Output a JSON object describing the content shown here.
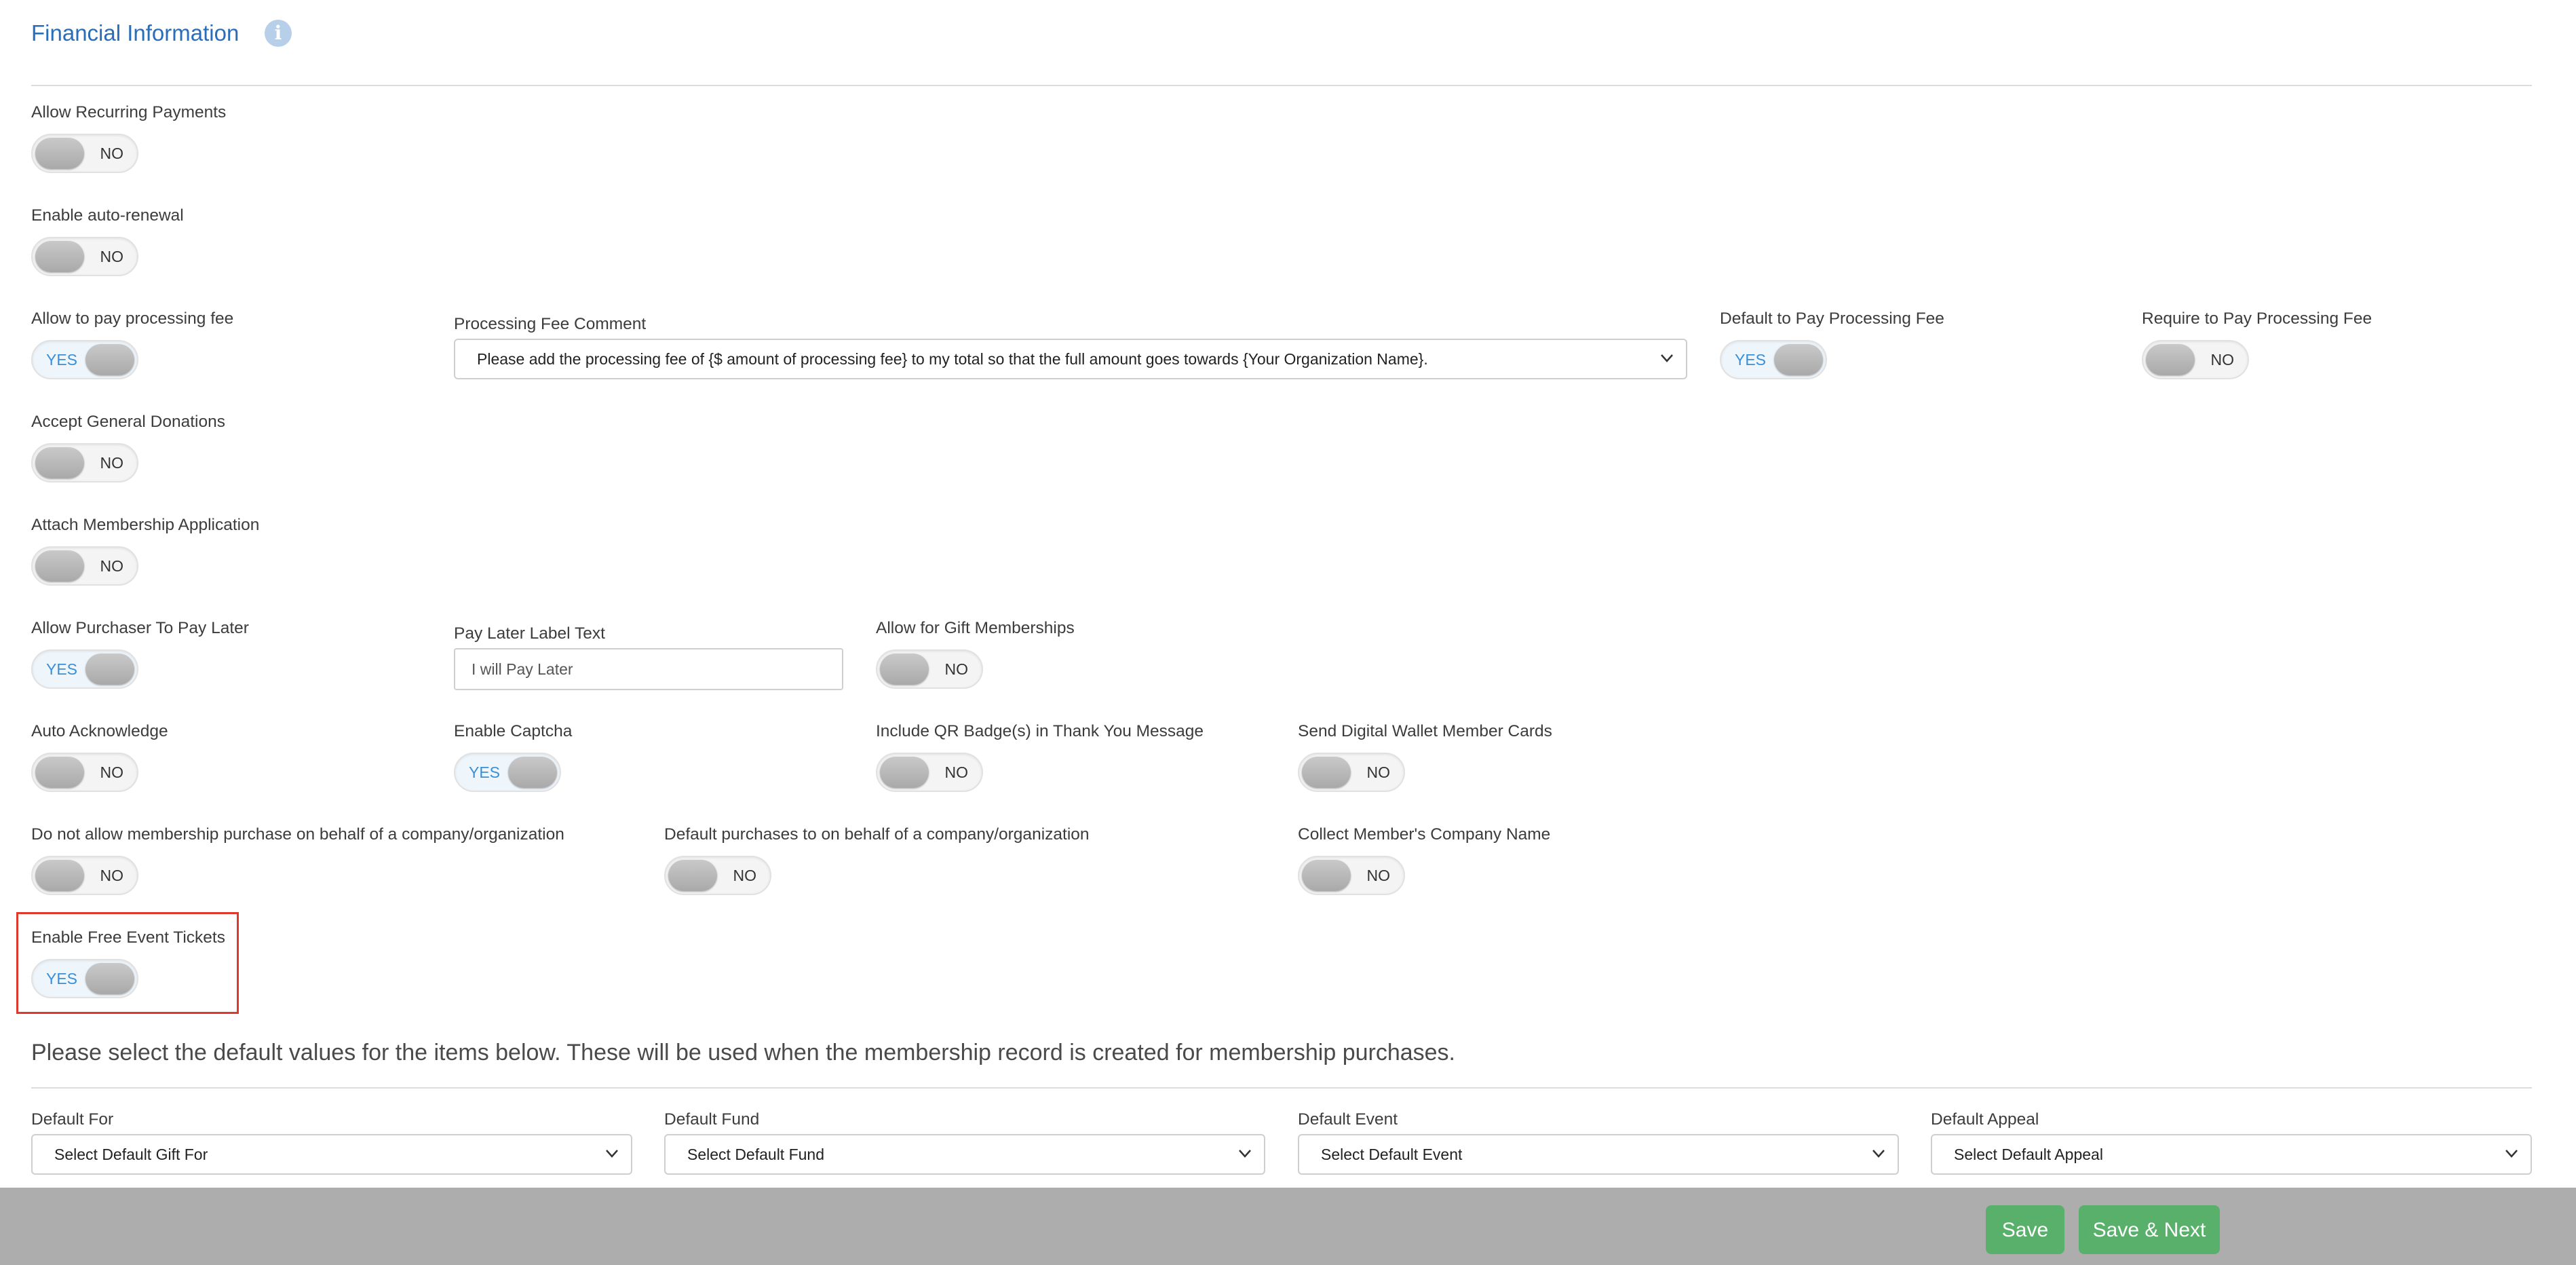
{
  "section": {
    "title": "Financial Information",
    "info_icon": "info-icon"
  },
  "fields": {
    "allow_recurring": {
      "label": "Allow Recurring Payments",
      "value": "NO"
    },
    "auto_renewal": {
      "label": "Enable auto-renewal",
      "value": "NO"
    },
    "pay_processing_fee": {
      "label": "Allow to pay processing fee",
      "value": "YES"
    },
    "processing_fee_comment": {
      "label": "Processing Fee Comment",
      "value": "Please add the processing fee of {$ amount of processing fee} to my total so that the full amount goes towards {Your Organization Name}."
    },
    "default_pay_fee": {
      "label": "Default to Pay Processing Fee",
      "value": "YES"
    },
    "require_pay_fee": {
      "label": "Require to Pay Processing Fee",
      "value": "NO"
    },
    "general_donations": {
      "label": "Accept General Donations",
      "value": "NO"
    },
    "attach_application": {
      "label": "Attach Membership Application",
      "value": "NO"
    },
    "pay_later": {
      "label": "Allow Purchaser To Pay Later",
      "value": "YES"
    },
    "pay_later_label": {
      "label": "Pay Later Label Text",
      "value": "I will Pay Later"
    },
    "gift_memberships": {
      "label": "Allow for Gift Memberships",
      "value": "NO"
    },
    "auto_acknowledge": {
      "label": "Auto Acknowledge",
      "value": "NO"
    },
    "captcha": {
      "label": "Enable Captcha",
      "value": "YES"
    },
    "qr_badges": {
      "label": "Include QR Badge(s) in Thank You Message",
      "value": "NO"
    },
    "wallet_cards": {
      "label": "Send Digital Wallet Member Cards",
      "value": "NO"
    },
    "no_company_purchase": {
      "label": "Do not allow membership purchase on behalf of a company/organization",
      "value": "NO"
    },
    "default_company_purchase": {
      "label": "Default purchases to on behalf of a company/organization",
      "value": "NO"
    },
    "collect_company": {
      "label": "Collect Member's Company Name",
      "value": "NO"
    },
    "free_event_tickets": {
      "label": "Enable Free Event Tickets",
      "value": "YES"
    }
  },
  "defaults_note": "Please select the default values for the items below. These will be used when the membership record is created for membership purchases.",
  "defaults": {
    "for": {
      "label": "Default For",
      "value": "Select Default Gift For"
    },
    "fund": {
      "label": "Default Fund",
      "value": "Select Default Fund"
    },
    "event": {
      "label": "Default Event",
      "value": "Select Default Event"
    },
    "appeal": {
      "label": "Default Appeal",
      "value": "Select Default Appeal"
    }
  },
  "footer": {
    "save_label": "Save",
    "save_next_label": "Save & Next"
  },
  "colors": {
    "accent_blue": "#2a6db8",
    "toggle_yes_text": "#3b8fd6",
    "button_green": "#58b06b",
    "highlight_red": "#e0392b",
    "footer_bg": "#adadad"
  }
}
